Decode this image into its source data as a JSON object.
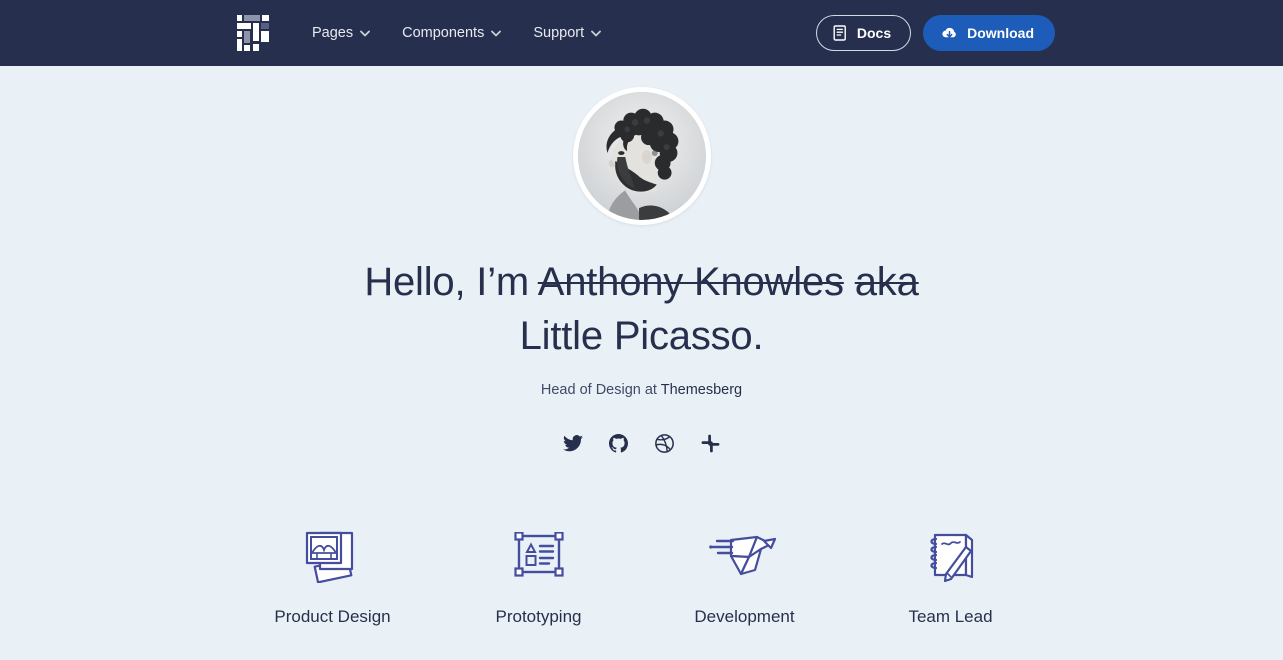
{
  "colors": {
    "navbar_bg": "#262f4e",
    "page_bg": "#eaf1f6",
    "accent_blue": "#1d5cb8",
    "heading": "#26304d",
    "icon_indigo": "#454e9e"
  },
  "navbar": {
    "logo_name": "themesberg-pixel-logo",
    "links": [
      {
        "label": "Pages",
        "icon": "chevron-down-icon"
      },
      {
        "label": "Components",
        "icon": "chevron-down-icon"
      },
      {
        "label": "Support",
        "icon": "chevron-down-icon"
      }
    ],
    "docs_button": {
      "label": "Docs",
      "icon": "book-icon"
    },
    "download_button": {
      "label": "Download",
      "icon": "cloud-download-icon"
    }
  },
  "hero": {
    "avatar_alt": "portrait-photo-black-and-white",
    "heading": {
      "greeting": "Hello, I’m ",
      "struck_name": "Anthony Knowles aka",
      "struck_part_one": "Anthony Knowles",
      "struck_part_two": "aka",
      "nickname": " Little Picasso."
    },
    "subtitle": {
      "prefix": "Head of Design at ",
      "company": "Themesberg"
    },
    "socials": [
      {
        "name": "twitter-icon",
        "label": "Twitter"
      },
      {
        "name": "github-icon",
        "label": "GitHub"
      },
      {
        "name": "dribbble-icon",
        "label": "Dribbble"
      },
      {
        "name": "slack-icon",
        "label": "Slack"
      }
    ]
  },
  "features": [
    {
      "label": "Product Design",
      "icon": "photo-stack-icon"
    },
    {
      "label": "Prototyping",
      "icon": "wireframe-icon"
    },
    {
      "label": "Development",
      "icon": "paper-bird-icon"
    },
    {
      "label": "Team Lead",
      "icon": "notepad-pencil-icon"
    }
  ]
}
